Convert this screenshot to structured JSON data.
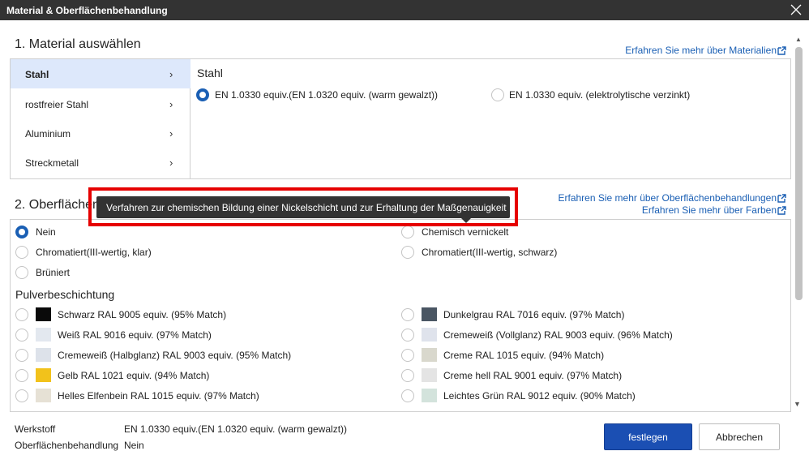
{
  "window": {
    "title": "Material & Oberflächenbehandlung"
  },
  "material": {
    "heading": "1. Material auswählen",
    "learn_more": "Erfahren Sie mehr über Materialien",
    "categories": [
      {
        "label": "Stahl"
      },
      {
        "label": "rostfreier Stahl"
      },
      {
        "label": "Aluminium"
      },
      {
        "label": "Streckmetall"
      }
    ],
    "selected_category": "Stahl",
    "panel_title": "Stahl",
    "options": [
      {
        "label": "EN 1.0330 equiv.(EN 1.0320 equiv. (warm gewalzt))",
        "selected": true
      },
      {
        "label": "EN 1.0330 equiv. (elektrolytische verzinkt)",
        "selected": false
      }
    ]
  },
  "surface": {
    "heading": "2. Oberflächenbehandlung auswählen",
    "learn_more_surface": "Erfahren Sie mehr über Oberflächenbehandlungen",
    "learn_more_colors": "Erfahren Sie mehr über Farben",
    "options_left": [
      {
        "label": "Nein",
        "selected": true
      },
      {
        "label": "Chromatiert(III-wertig, klar)",
        "selected": false
      },
      {
        "label": "Brüniert",
        "selected": false
      }
    ],
    "options_right": [
      {
        "label": "Chemisch vernickelt",
        "selected": false
      },
      {
        "label": "Chromatiert(III-wertig, schwarz)",
        "selected": false
      }
    ],
    "powder_heading": "Pulverbeschichtung",
    "powder_left": [
      {
        "label": "Schwarz RAL 9005 equiv. (95% Match)",
        "color": "#0a0a0a"
      },
      {
        "label": "Weiß RAL 9016 equiv. (97% Match)",
        "color": "#e3e8ef"
      },
      {
        "label": "Cremeweiß (Halbglanz) RAL 9003 equiv. (95% Match)",
        "color": "#dde2ea"
      },
      {
        "label": "Gelb RAL 1021 equiv. (94% Match)",
        "color": "#f2c21b"
      },
      {
        "label": "Helles Elfenbein RAL 1015 equiv. (97% Match)",
        "color": "#e6e1d5"
      }
    ],
    "powder_right": [
      {
        "label": "Dunkelgrau RAL 7016 equiv. (97% Match)",
        "color": "#4a5663"
      },
      {
        "label": "Cremeweiß (Vollglanz) RAL 9003 equiv. (96% Match)",
        "color": "#dfe3ec"
      },
      {
        "label": "Creme RAL 1015 equiv. (94% Match)",
        "color": "#d9d8cd"
      },
      {
        "label": "Creme hell RAL 9001 equiv. (97% Match)",
        "color": "#e4e4e4"
      },
      {
        "label": "Leichtes Grün RAL 9012 equiv. (90% Match)",
        "color": "#d3e3dc"
      }
    ]
  },
  "tooltip": {
    "text": "Verfahren zur chemischen Bildung einer Nickelschicht und zur Erhaltung der Maßgenauigkeit"
  },
  "summary": {
    "material_label": "Werkstoff",
    "material_value": "EN 1.0330 equiv.(EN 1.0320 equiv. (warm gewalzt))",
    "surface_label": "Oberflächenbehandlung",
    "surface_value": "Nein"
  },
  "buttons": {
    "confirm": "festlegen",
    "cancel": "Abbrechen"
  },
  "colors": {
    "accent": "#1b4fb3",
    "link": "#1a5fb4",
    "titlebar": "#333333",
    "highlight": "#e60000",
    "active_item": "#dde8fb"
  }
}
